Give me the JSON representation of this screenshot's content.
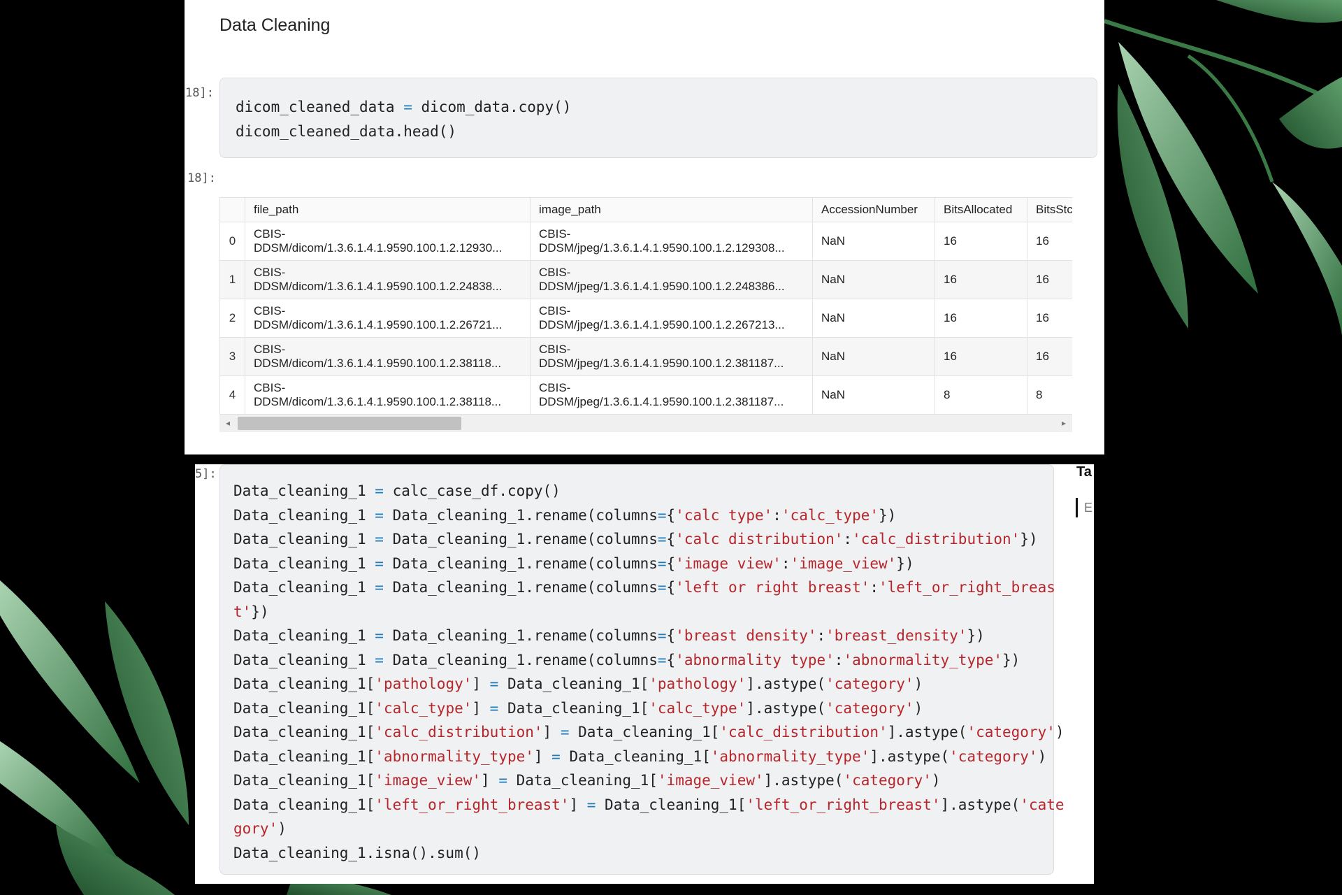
{
  "notebook": {
    "section_heading": "Data Cleaning",
    "cell1": {
      "in_prompt": "18]:",
      "out_prompt": "18]:",
      "code": [
        [
          {
            "t": "dicom_cleaned_data "
          },
          {
            "t": "=",
            "c": "op"
          },
          {
            "t": " dicom_data.copy()"
          }
        ],
        [
          {
            "t": "dicom_cleaned_data.head()"
          }
        ]
      ]
    },
    "dataframe": {
      "columns": [
        "",
        "file_path",
        "image_path",
        "AccessionNumber",
        "BitsAllocated",
        "BitsStc"
      ],
      "rows": [
        {
          "index": "0",
          "file_path": [
            "CBIS-",
            "DDSM/dicom/1.3.6.1.4.1.9590.100.1.2.12930..."
          ],
          "image_path": [
            "CBIS-",
            "DDSM/jpeg/1.3.6.1.4.1.9590.100.1.2.129308..."
          ],
          "AccessionNumber": "NaN",
          "BitsAllocated": "16",
          "BitsStored": "16"
        },
        {
          "index": "1",
          "file_path": [
            "CBIS-",
            "DDSM/dicom/1.3.6.1.4.1.9590.100.1.2.24838..."
          ],
          "image_path": [
            "CBIS-",
            "DDSM/jpeg/1.3.6.1.4.1.9590.100.1.2.248386..."
          ],
          "AccessionNumber": "NaN",
          "BitsAllocated": "16",
          "BitsStored": "16"
        },
        {
          "index": "2",
          "file_path": [
            "CBIS-",
            "DDSM/dicom/1.3.6.1.4.1.9590.100.1.2.26721..."
          ],
          "image_path": [
            "CBIS-",
            "DDSM/jpeg/1.3.6.1.4.1.9590.100.1.2.267213..."
          ],
          "AccessionNumber": "NaN",
          "BitsAllocated": "16",
          "BitsStored": "16"
        },
        {
          "index": "3",
          "file_path": [
            "CBIS-",
            "DDSM/dicom/1.3.6.1.4.1.9590.100.1.2.38118..."
          ],
          "image_path": [
            "CBIS-",
            "DDSM/jpeg/1.3.6.1.4.1.9590.100.1.2.381187..."
          ],
          "AccessionNumber": "NaN",
          "BitsAllocated": "16",
          "BitsStored": "16"
        },
        {
          "index": "4",
          "file_path": [
            "CBIS-",
            "DDSM/dicom/1.3.6.1.4.1.9590.100.1.2.38118..."
          ],
          "image_path": [
            "CBIS-",
            "DDSM/jpeg/1.3.6.1.4.1.9590.100.1.2.381187..."
          ],
          "AccessionNumber": "NaN",
          "BitsAllocated": "8",
          "BitsStored": "8"
        }
      ]
    },
    "cell2": {
      "in_prompt": "5]:",
      "code": [
        [
          {
            "t": "Data_cleaning_1 "
          },
          {
            "t": "=",
            "c": "op"
          },
          {
            "t": " calc_case_df.copy()"
          }
        ],
        [
          {
            "t": "Data_cleaning_1 "
          },
          {
            "t": "=",
            "c": "op"
          },
          {
            "t": " Data_cleaning_1.rename(columns"
          },
          {
            "t": "=",
            "c": "op"
          },
          {
            "t": "{"
          },
          {
            "t": "'calc type'",
            "c": "str"
          },
          {
            "t": ":"
          },
          {
            "t": "'calc_type'",
            "c": "str"
          },
          {
            "t": "})"
          }
        ],
        [
          {
            "t": "Data_cleaning_1 "
          },
          {
            "t": "=",
            "c": "op"
          },
          {
            "t": " Data_cleaning_1.rename(columns"
          },
          {
            "t": "=",
            "c": "op"
          },
          {
            "t": "{"
          },
          {
            "t": "'calc distribution'",
            "c": "str"
          },
          {
            "t": ":"
          },
          {
            "t": "'calc_distribution'",
            "c": "str"
          },
          {
            "t": "})"
          }
        ],
        [
          {
            "t": "Data_cleaning_1 "
          },
          {
            "t": "=",
            "c": "op"
          },
          {
            "t": " Data_cleaning_1.rename(columns"
          },
          {
            "t": "=",
            "c": "op"
          },
          {
            "t": "{"
          },
          {
            "t": "'image view'",
            "c": "str"
          },
          {
            "t": ":"
          },
          {
            "t": "'image_view'",
            "c": "str"
          },
          {
            "t": "})"
          }
        ],
        [
          {
            "t": "Data_cleaning_1 "
          },
          {
            "t": "=",
            "c": "op"
          },
          {
            "t": " Data_cleaning_1.rename(columns"
          },
          {
            "t": "=",
            "c": "op"
          },
          {
            "t": "{"
          },
          {
            "t": "'left or right breast'",
            "c": "str"
          },
          {
            "t": ":"
          },
          {
            "t": "'left_or_right_breas",
            "c": "str"
          }
        ],
        [
          {
            "t": "t'",
            "c": "str"
          },
          {
            "t": "})"
          }
        ],
        [
          {
            "t": "Data_cleaning_1 "
          },
          {
            "t": "=",
            "c": "op"
          },
          {
            "t": " Data_cleaning_1.rename(columns"
          },
          {
            "t": "=",
            "c": "op"
          },
          {
            "t": "{"
          },
          {
            "t": "'breast density'",
            "c": "str"
          },
          {
            "t": ":"
          },
          {
            "t": "'breast_density'",
            "c": "str"
          },
          {
            "t": "})"
          }
        ],
        [
          {
            "t": "Data_cleaning_1 "
          },
          {
            "t": "=",
            "c": "op"
          },
          {
            "t": " Data_cleaning_1.rename(columns"
          },
          {
            "t": "=",
            "c": "op"
          },
          {
            "t": "{"
          },
          {
            "t": "'abnormality type'",
            "c": "str"
          },
          {
            "t": ":"
          },
          {
            "t": "'abnormality_type'",
            "c": "str"
          },
          {
            "t": "})"
          }
        ],
        [
          {
            "t": "Data_cleaning_1["
          },
          {
            "t": "'pathology'",
            "c": "str"
          },
          {
            "t": "] "
          },
          {
            "t": "=",
            "c": "op"
          },
          {
            "t": " Data_cleaning_1["
          },
          {
            "t": "'pathology'",
            "c": "str"
          },
          {
            "t": "].astype("
          },
          {
            "t": "'category'",
            "c": "str"
          },
          {
            "t": ")"
          }
        ],
        [
          {
            "t": "Data_cleaning_1["
          },
          {
            "t": "'calc_type'",
            "c": "str"
          },
          {
            "t": "] "
          },
          {
            "t": "=",
            "c": "op"
          },
          {
            "t": " Data_cleaning_1["
          },
          {
            "t": "'calc_type'",
            "c": "str"
          },
          {
            "t": "].astype("
          },
          {
            "t": "'category'",
            "c": "str"
          },
          {
            "t": ")"
          }
        ],
        [
          {
            "t": "Data_cleaning_1["
          },
          {
            "t": "'calc_distribution'",
            "c": "str"
          },
          {
            "t": "] "
          },
          {
            "t": "=",
            "c": "op"
          },
          {
            "t": " Data_cleaning_1["
          },
          {
            "t": "'calc_distribution'",
            "c": "str"
          },
          {
            "t": "].astype("
          },
          {
            "t": "'category'",
            "c": "str"
          },
          {
            "t": ")"
          }
        ],
        [
          {
            "t": "Data_cleaning_1["
          },
          {
            "t": "'abnormality_type'",
            "c": "str"
          },
          {
            "t": "] "
          },
          {
            "t": "=",
            "c": "op"
          },
          {
            "t": " Data_cleaning_1["
          },
          {
            "t": "'abnormality_type'",
            "c": "str"
          },
          {
            "t": "].astype("
          },
          {
            "t": "'category'",
            "c": "str"
          },
          {
            "t": ")"
          }
        ],
        [
          {
            "t": "Data_cleaning_1["
          },
          {
            "t": "'image_view'",
            "c": "str"
          },
          {
            "t": "] "
          },
          {
            "t": "=",
            "c": "op"
          },
          {
            "t": " Data_cleaning_1["
          },
          {
            "t": "'image_view'",
            "c": "str"
          },
          {
            "t": "].astype("
          },
          {
            "t": "'category'",
            "c": "str"
          },
          {
            "t": ")"
          }
        ],
        [
          {
            "t": "Data_cleaning_1["
          },
          {
            "t": "'left_or_right_breast'",
            "c": "str"
          },
          {
            "t": "] "
          },
          {
            "t": "=",
            "c": "op"
          },
          {
            "t": " Data_cleaning_1["
          },
          {
            "t": "'left_or_right_breast'",
            "c": "str"
          },
          {
            "t": "].astype("
          },
          {
            "t": "'cate",
            "c": "str"
          }
        ],
        [
          {
            "t": "gory'",
            "c": "str"
          },
          {
            "t": ")"
          }
        ],
        [
          {
            "t": "Data_cleaning_1.isna().sum()"
          }
        ]
      ]
    },
    "side_fragment": "Ta",
    "side_fragment_2": "E"
  },
  "colors": {
    "background": "#000000",
    "code_bg": "#f0f1f3",
    "operator": "#1e7bb8",
    "string": "#b6262b",
    "leaf_dark": "#2f6e3e",
    "leaf_light": "#8fc59a"
  },
  "icons": {
    "scroll_left": "◂",
    "scroll_right": "▸"
  }
}
